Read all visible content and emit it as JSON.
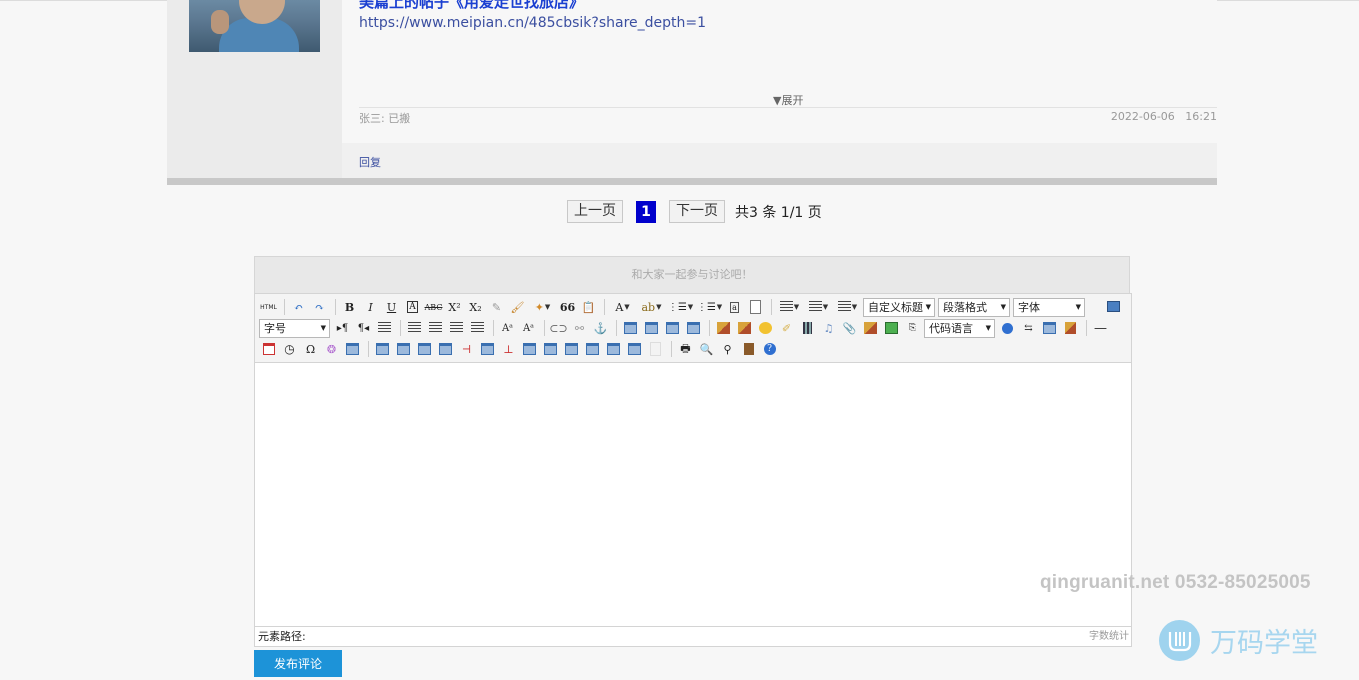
{
  "post": {
    "title": "美篇上的帖子《用爱走世找旅店》",
    "link": "https://www.meipian.cn/485cbsik?share_depth=1",
    "expand_label": "▼展开",
    "user_status": "张三: 已搬",
    "date": "2022-06-06",
    "time": "16:21",
    "reply_label": "回复"
  },
  "pagination": {
    "prev_label": "上一页",
    "current_page": "1",
    "next_label": "下一页",
    "total_text": "共3 条 1/1 页"
  },
  "comment": {
    "prompt": "和大家一起参与讨论吧！",
    "toolbar": {
      "html_label": "HTML",
      "heading_select": "自定义标题",
      "paragraph_select": "段落格式",
      "font_select": "字体",
      "fontsize_select": "字号",
      "code_select": "代码语言"
    },
    "element_path_label": "元素路径:",
    "word_count_label": "字数统计",
    "submit_label": "发布评论"
  },
  "watermark": {
    "contact": "qingruanit.net 0532-85025005",
    "brand": "万码学堂"
  },
  "colors": {
    "link": "#3b4fa0",
    "title": "#1a3fd1",
    "current_page_bg": "#0000cc",
    "submit_bg": "#1d93d8",
    "watermark": "#a7d6ef"
  }
}
